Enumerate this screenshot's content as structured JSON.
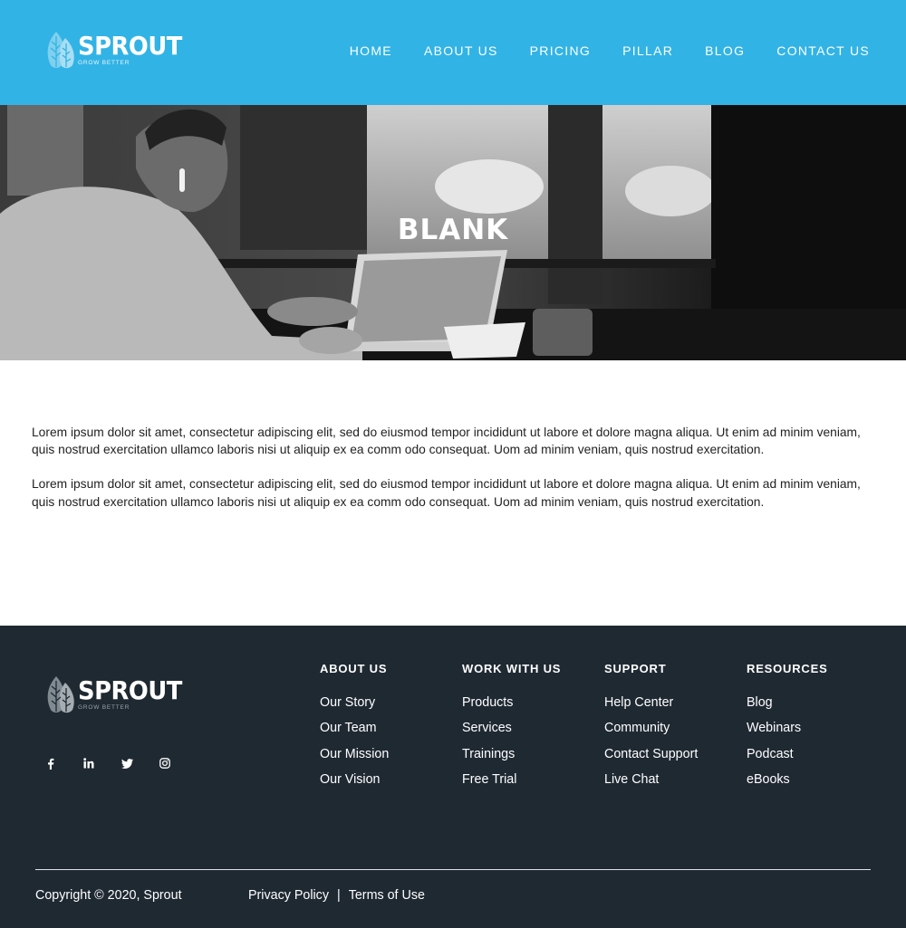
{
  "brand": {
    "name": "SPROUT",
    "tagline": "GROW BETTER"
  },
  "nav": [
    {
      "label": "HOME"
    },
    {
      "label": "ABOUT US"
    },
    {
      "label": "PRICING"
    },
    {
      "label": "PILLAR"
    },
    {
      "label": "BLOG"
    },
    {
      "label": "CONTACT US"
    }
  ],
  "hero": {
    "title": "BLANK"
  },
  "content": {
    "paragraphs": [
      "Lorem ipsum dolor sit amet, consectetur adipiscing elit, sed do eiusmod tempor incididunt ut labore et dolore magna aliqua. Ut enim ad minim veniam, quis nostrud exercitation ullamco laboris nisi ut aliquip ex ea comm odo consequat. Uom ad minim veniam, quis nostrud exercitation.",
      "Lorem ipsum dolor sit amet, consectetur adipiscing elit, sed do eiusmod tempor incididunt ut labore et dolore magna aliqua. Ut enim ad minim veniam, quis nostrud exercitation ullamco laboris nisi ut aliquip ex ea comm odo consequat. Uom ad minim veniam, quis nostrud exercitation."
    ]
  },
  "footer": {
    "social": [
      "facebook-icon",
      "linkedin-icon",
      "twitter-icon",
      "instagram-icon"
    ],
    "columns": [
      {
        "title": "ABOUT US",
        "links": [
          "Our Story",
          "Our Team",
          "Our Mission",
          "Our Vision"
        ]
      },
      {
        "title": "WORK WITH US",
        "links": [
          "Products",
          "Services",
          "Trainings",
          "Free Trial"
        ]
      },
      {
        "title": "SUPPORT",
        "links": [
          "Help Center",
          "Community",
          "Contact Support",
          "Live Chat"
        ]
      },
      {
        "title": "RESOURCES",
        "links": [
          "Blog",
          "Webinars",
          "Podcast",
          "eBooks"
        ]
      }
    ],
    "copyright": "Copyright © 2020, Sprout",
    "legal": {
      "privacy": "Privacy Policy",
      "separator": "|",
      "terms": "Terms of Use"
    }
  },
  "colors": {
    "header_bg": "#32b3e5",
    "footer_bg": "#1f2932",
    "text": "#222222"
  }
}
